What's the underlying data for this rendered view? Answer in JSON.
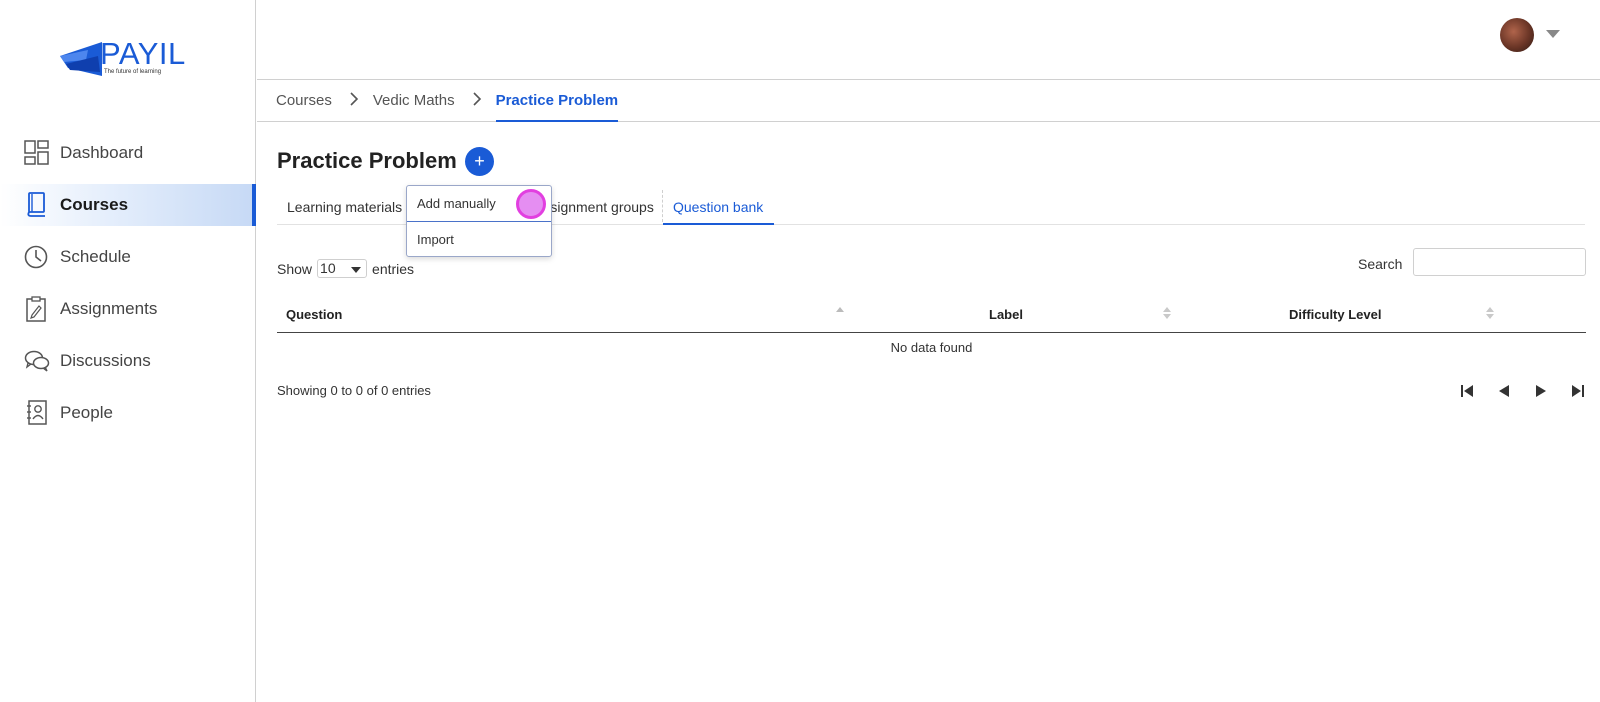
{
  "brand": {
    "name": "PAYIL",
    "tagline": "The future of learning",
    "color": "#1a5bd6"
  },
  "sidebar": {
    "items": [
      {
        "label": "Dashboard",
        "icon": "dashboard-icon"
      },
      {
        "label": "Courses",
        "icon": "book-icon",
        "active": true
      },
      {
        "label": "Schedule",
        "icon": "clock-icon"
      },
      {
        "label": "Assignments",
        "icon": "clipboard-icon"
      },
      {
        "label": "Discussions",
        "icon": "chat-bubbles-icon"
      },
      {
        "label": "People",
        "icon": "contacts-icon"
      }
    ]
  },
  "header": {
    "avatar": "user-avatar",
    "menu_icon": "caret-down-icon"
  },
  "breadcrumb": [
    "Courses",
    "Vedic Maths",
    "Practice Problem"
  ],
  "page": {
    "title": "Practice Problem",
    "add_icon": "+"
  },
  "tabs": [
    {
      "label": "Learning materials"
    },
    {
      "label": "Assignment groups"
    },
    {
      "label": "Question bank",
      "active": true
    }
  ],
  "dropdown": {
    "items": [
      "Add manually",
      "Import"
    ]
  },
  "table": {
    "show_label": "Show",
    "entries_value": "10",
    "entries_label": "entries",
    "search_label": "Search",
    "search_value": "",
    "columns": [
      "Question",
      "Label",
      "Difficulty Level"
    ],
    "empty_text": "No data found",
    "summary": "Showing 0 to 0 of 0 entries"
  },
  "pager": [
    "first-page-icon",
    "prev-page-icon",
    "next-page-icon",
    "last-page-icon"
  ]
}
